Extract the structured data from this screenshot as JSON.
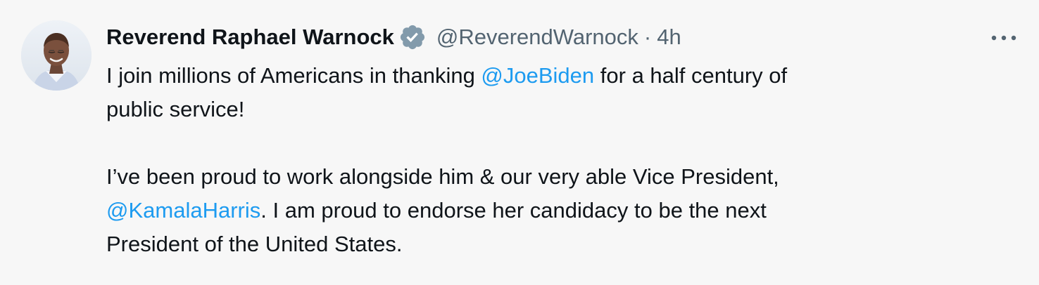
{
  "author": {
    "display_name": "Reverend Raphael Warnock",
    "handle": "@ReverendWarnock",
    "separator": "·",
    "time": "4h",
    "verified": true
  },
  "body": {
    "line1_before": "I join millions of Americans in thanking ",
    "line1_mention": "@JoeBiden",
    "line1_after": " for a half century of",
    "line2": "public service!",
    "line3": "I’ve been proud to work alongside him & our very able Vice President,",
    "line4_mention": "@KamalaHarris",
    "line4_after": ". I am proud to endorse her candidacy to be the next",
    "line5": "President of the United States."
  },
  "icons": {
    "verified_badge": "verified-badge-icon",
    "more": "more-options-icon",
    "avatar": "profile-avatar"
  },
  "colors": {
    "background": "#f7f7f7",
    "text": "#0f1419",
    "muted": "#536471",
    "link": "#1d9bf0",
    "badge": "#829aab"
  }
}
